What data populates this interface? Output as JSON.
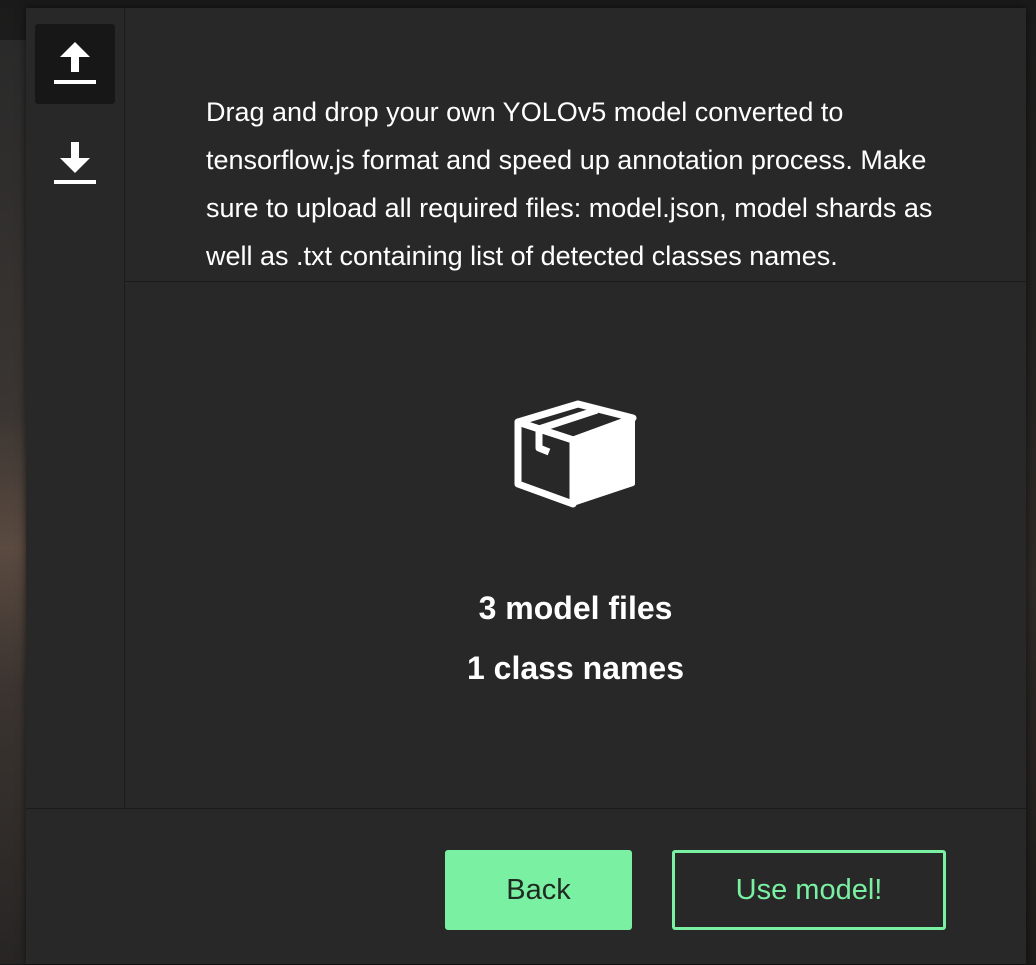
{
  "colors": {
    "accent": "#7af0a2",
    "popup_background": "#282828",
    "active_tab_background": "#171717",
    "text": "#ffffff"
  },
  "sidebar": {
    "items": [
      {
        "icon": "upload-icon",
        "active": true
      },
      {
        "icon": "download-icon",
        "active": false
      }
    ]
  },
  "description": "Drag and drop your own YOLOv5 model converted to tensorflow.js format and speed up annotation process. Make sure to upload all required files: model.json, model shards as well as .txt containing list of detected classes names.",
  "dropzone": {
    "icon": "box-icon",
    "model_files_label": "3 model files",
    "class_names_label": "1 class names"
  },
  "footer": {
    "back_label": "Back",
    "use_model_label": "Use model!"
  }
}
